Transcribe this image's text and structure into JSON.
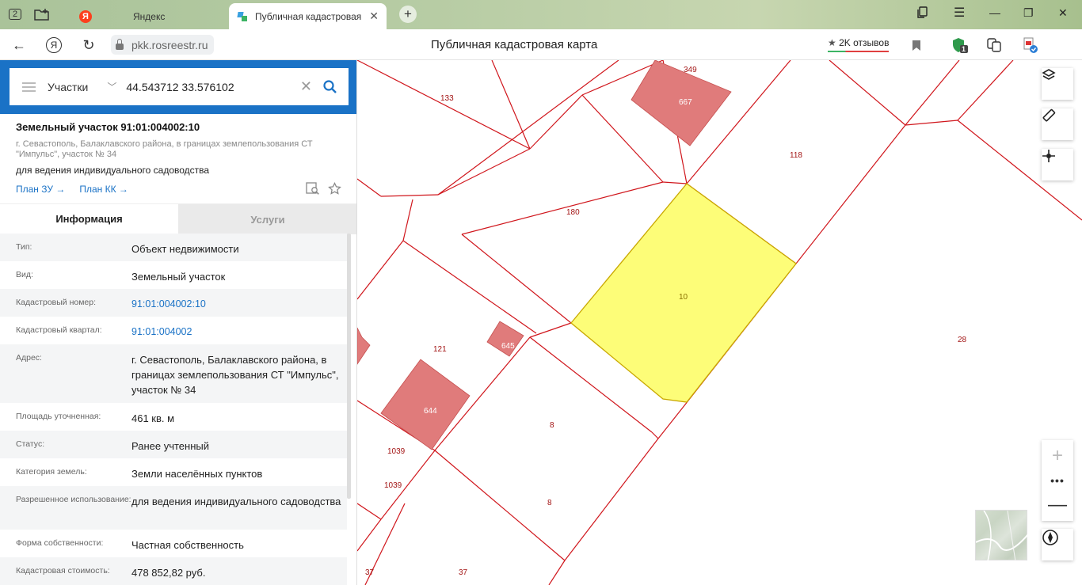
{
  "browser": {
    "tab_count": "2",
    "tabs": [
      {
        "label": "Яндекс"
      },
      {
        "label": "Публичная кадастровая"
      }
    ],
    "url": "pkk.rosreestr.ru",
    "page_title": "Публичная кадастровая карта",
    "reviews_label": "2K отзывов",
    "ext_badge": "1",
    "yandex_letter": "Я"
  },
  "search": {
    "type": "Участки",
    "value": "44.543712 33.576102"
  },
  "object": {
    "title": "Земельный участок 91:01:004002:10",
    "address_short": "г. Севастополь, Балаклавского района, в границах землепользования СТ \"Импульс\", участок № 34",
    "usage": "для ведения индивидуального садоводства",
    "links": [
      "План ЗУ →",
      "План КК →"
    ]
  },
  "tabs": {
    "info": "Информация",
    "services": "Услуги"
  },
  "info_rows": [
    {
      "key": "Тип:",
      "value": "Объект недвижимости"
    },
    {
      "key": "Вид:",
      "value": "Земельный участок"
    },
    {
      "key": "Кадастровый номер:",
      "value": "91:01:004002:10"
    },
    {
      "key": "Кадастровый квартал:",
      "value": "91:01:004002"
    },
    {
      "key": "Адрес:",
      "value": "г. Севастополь, Балаклавского района, в границах землепользования СТ \"Импульс\", участок № 34"
    },
    {
      "key": "Площадь уточненная:",
      "value": "461 кв. м"
    },
    {
      "key": "Статус:",
      "value": "Ранее учтенный"
    },
    {
      "key": "Категория земель:",
      "value": "Земли населённых пунктов"
    },
    {
      "key": "Разрешенное использование:",
      "value": "для ведения индивидуального садоводства"
    },
    {
      "key": "Форма собственности:",
      "value": "Частная собственность"
    },
    {
      "key": "Кадастровая стоимость:",
      "value": "478 852,82 руб."
    }
  ],
  "map": {
    "labels": [
      "133",
      "349",
      "667",
      "118",
      "180",
      "10",
      "28",
      "121",
      "645",
      "644",
      "8",
      "1039",
      "1039",
      "8",
      "37",
      "37"
    ],
    "colors": {
      "boundary": "#d0161c",
      "selected_fill": "#fdfd78",
      "selected_stroke": "#c9a800",
      "building_fill": "#e07b7b"
    }
  }
}
